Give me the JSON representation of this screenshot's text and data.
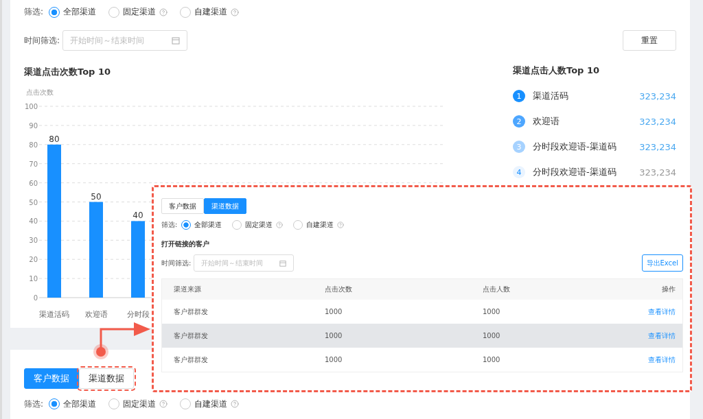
{
  "filter": {
    "label": "筛选:",
    "options": [
      {
        "label": "全部渠道",
        "selected": true,
        "help": false
      },
      {
        "label": "固定渠道",
        "selected": false,
        "help": true
      },
      {
        "label": "自建渠道",
        "selected": false,
        "help": true
      }
    ]
  },
  "time_filter": {
    "label": "时间筛选:",
    "placeholder": "开始时间～结束时间"
  },
  "reset_button": "重置",
  "clicks_chart": {
    "title": "渠道点击次数Top 10",
    "chart_data": {
      "type": "bar",
      "ylabel": "点击次数",
      "categories": [
        "渠道活码",
        "欢迎语",
        "分时段"
      ],
      "values": [
        80,
        50,
        40
      ],
      "ylim": [
        0,
        100
      ],
      "grid": true,
      "yticks": [
        0,
        10,
        20,
        30,
        40,
        50,
        60,
        70,
        80,
        90,
        100
      ],
      "data_labels": true
    }
  },
  "visitors_ranking": {
    "title": "渠道点击人数Top 10",
    "items": [
      {
        "rank": "1",
        "name": "渠道活码",
        "value": "323,234",
        "color": "#1890ff",
        "highlight": true
      },
      {
        "rank": "2",
        "name": "欢迎语",
        "value": "323,234",
        "color": "#4da6ff",
        "highlight": true
      },
      {
        "rank": "3",
        "name": "分时段欢迎语-渠道码",
        "value": "323,234",
        "color": "#a6d2ff",
        "highlight": true
      },
      {
        "rank": "4",
        "name": "分时段欢迎语-渠道码",
        "value": "323,234",
        "color": "#eaf4ff",
        "highlight": false
      }
    ]
  },
  "callout": {
    "tabs": [
      {
        "label": "客户数据",
        "selected": false
      },
      {
        "label": "渠道数据",
        "selected": true
      }
    ],
    "filter": {
      "label": "筛选:",
      "options": [
        {
          "label": "全部渠道",
          "selected": true,
          "help": false
        },
        {
          "label": "固定渠道",
          "selected": false,
          "help": true
        },
        {
          "label": "自建渠道",
          "selected": false,
          "help": true
        }
      ]
    },
    "subtitle": "打开链接的客户",
    "time_filter": {
      "label": "时间筛选:",
      "placeholder": "开始时间～结束时间"
    },
    "export_button": "导出Excel",
    "table": {
      "columns": [
        "渠道来源",
        "点击次数",
        "点击人数",
        "操作"
      ],
      "rows": [
        {
          "source": "客户群群发",
          "clicks": "1000",
          "visitors": "1000",
          "action": "查看详情",
          "highlighted": false
        },
        {
          "source": "客户群群发",
          "clicks": "1000",
          "visitors": "1000",
          "action": "查看详情",
          "highlighted": true
        },
        {
          "source": "客户群群发",
          "clicks": "1000",
          "visitors": "1000",
          "action": "查看详情",
          "highlighted": false
        }
      ]
    }
  },
  "bottom_tabs": [
    {
      "label": "客户数据",
      "selected": true,
      "callout": false
    },
    {
      "label": "渠道数据",
      "selected": false,
      "callout": true
    }
  ],
  "bottom_filter": {
    "label": "筛选:",
    "options": [
      {
        "label": "全部渠道",
        "selected": true,
        "help": false
      },
      {
        "label": "固定渠道",
        "selected": false,
        "help": true
      },
      {
        "label": "自建渠道",
        "selected": false,
        "help": true
      }
    ]
  }
}
